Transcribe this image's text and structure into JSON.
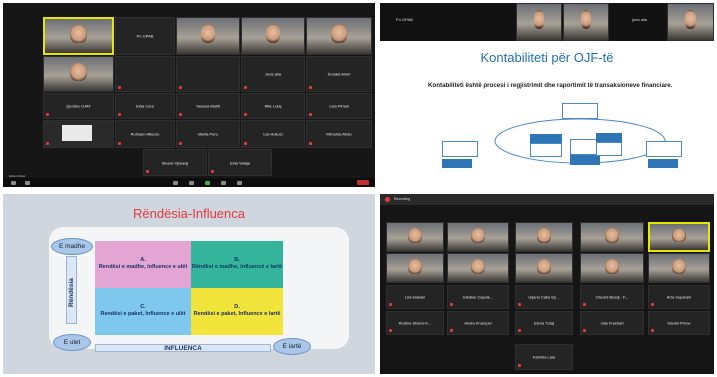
{
  "q1": {
    "top_row": [
      {
        "name": "",
        "video": true
      },
      {
        "name": "Pu OPAB",
        "video": false
      },
      {
        "name": "",
        "video": true
      },
      {
        "name": "",
        "video": true
      },
      {
        "name": "",
        "video": true
      }
    ],
    "row2": [
      {
        "name": "",
        "video": true
      },
      {
        "name": "",
        "video": false
      },
      {
        "name": "",
        "video": false
      },
      {
        "name": "Jona alia",
        "video": false
      },
      {
        "name": "Donald Amiri",
        "video": false
      }
    ],
    "row3": [
      "Qendra OJAT",
      "Elda Cura",
      "Yaxana Mahti",
      "Rite Lolaj",
      "Lisa Pimali"
    ],
    "row4": [
      "",
      "Ruhsam Alkuzio",
      "Marta Peru",
      "Lisi Hukuci",
      "Mimoida Abdu"
    ],
    "row5": [
      "Sleara Ojdueaj",
      "Elda Valaja"
    ],
    "corner_label": "Elida Akbasi"
  },
  "q2": {
    "strip_names": [
      "Pu OPAB",
      "",
      "jona alia",
      ""
    ],
    "title": "Kontabiliteti për OJF-të",
    "text": "Kontabiliteti është procesi i regjistrimit dhe raportimit të transaksioneve financiare."
  },
  "q3": {
    "title": "Rëndësia-Influenca",
    "cells": [
      {
        "letter": "A.",
        "text": "Rendësi e madhe, influence e ulët",
        "color": "#e3a6d4"
      },
      {
        "letter": "B.",
        "text": "Rëndësi e madhe, influencë e lartë",
        "color": "#34b49a"
      },
      {
        "letter": "C.",
        "text": "Rendësi e paket, Influence e ulët",
        "color": "#7ec8ee"
      },
      {
        "letter": "D.",
        "text": "Rendësi e paket, Influence e lartë",
        "color": "#f1e43a"
      }
    ],
    "e_madhe": "E madhe",
    "e_ulet": "E ulet",
    "e_larte": "E lartë",
    "influenca": "INFLUENCA",
    "rendesia": "Rëndësia"
  },
  "q4": {
    "recording": "Recording",
    "names_row3": [
      "Lira Hakani",
      "Gledise Capole...",
      "Uljana Cake Ep...",
      "Orecild Bezaj - F...",
      "Arta Suparani"
    ],
    "names_row4": [
      "Rudina Shehu-K...",
      "Anela Kruenpel",
      "Elena Tutaj",
      "Jola Frashari",
      "Daniel Prrevi"
    ],
    "names_row5": [
      "Fatmira Lala"
    ]
  },
  "colors": {
    "zoom_bg": "#161616",
    "tile_bg": "#242424",
    "slide_blue": "#1f6fb5",
    "title_red": "#e23a3a",
    "mic_red": "#e23b3b"
  }
}
